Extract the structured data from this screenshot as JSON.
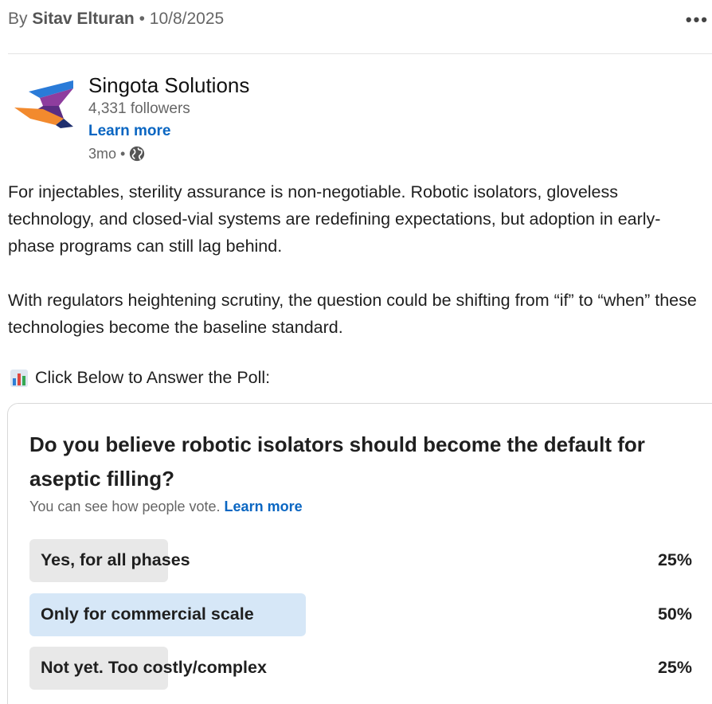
{
  "header": {
    "by_prefix": "By",
    "author": "Sitav Elturan",
    "separator": "•",
    "date": "10/8/2025",
    "more_label": "•••"
  },
  "company": {
    "name": "Singota Solutions",
    "followers": "4,331 followers",
    "learn_more": "Learn more",
    "age": "3mo •",
    "logo_icon": "singota-logo-icon",
    "visibility_icon": "globe-icon"
  },
  "post": {
    "paragraph1": "For injectables, sterility assurance is non-negotiable. Robotic isolators, gloveless technology, and closed-vial systems are redefining expectations, but adoption in early-phase programs can still lag behind.",
    "paragraph2": "With regulators heightening scrutiny, the question could be shifting from “if” to “when” these technologies become the baseline standard.",
    "poll_cta": "Click Below to Answer the Poll:",
    "poll_cta_icon": "bar-chart-icon"
  },
  "poll": {
    "question": "Do you believe robotic isolators should become the default for aseptic filling?",
    "visibility_text": "You can see how people vote.",
    "visibility_link": "Learn more",
    "options": [
      {
        "label": "Yes, for all phases",
        "percent_label": "25%",
        "share": 0.25,
        "selected": false
      },
      {
        "label": "Only for commercial scale",
        "percent_label": "50%",
        "share": 0.5,
        "selected": true
      },
      {
        "label": "Not yet. Too costly/complex",
        "percent_label": "25%",
        "share": 0.25,
        "selected": false
      }
    ]
  },
  "colors": {
    "link": "#0a66c2",
    "bar_default": "#e8e8e8",
    "bar_selected": "#d6e7f7"
  }
}
